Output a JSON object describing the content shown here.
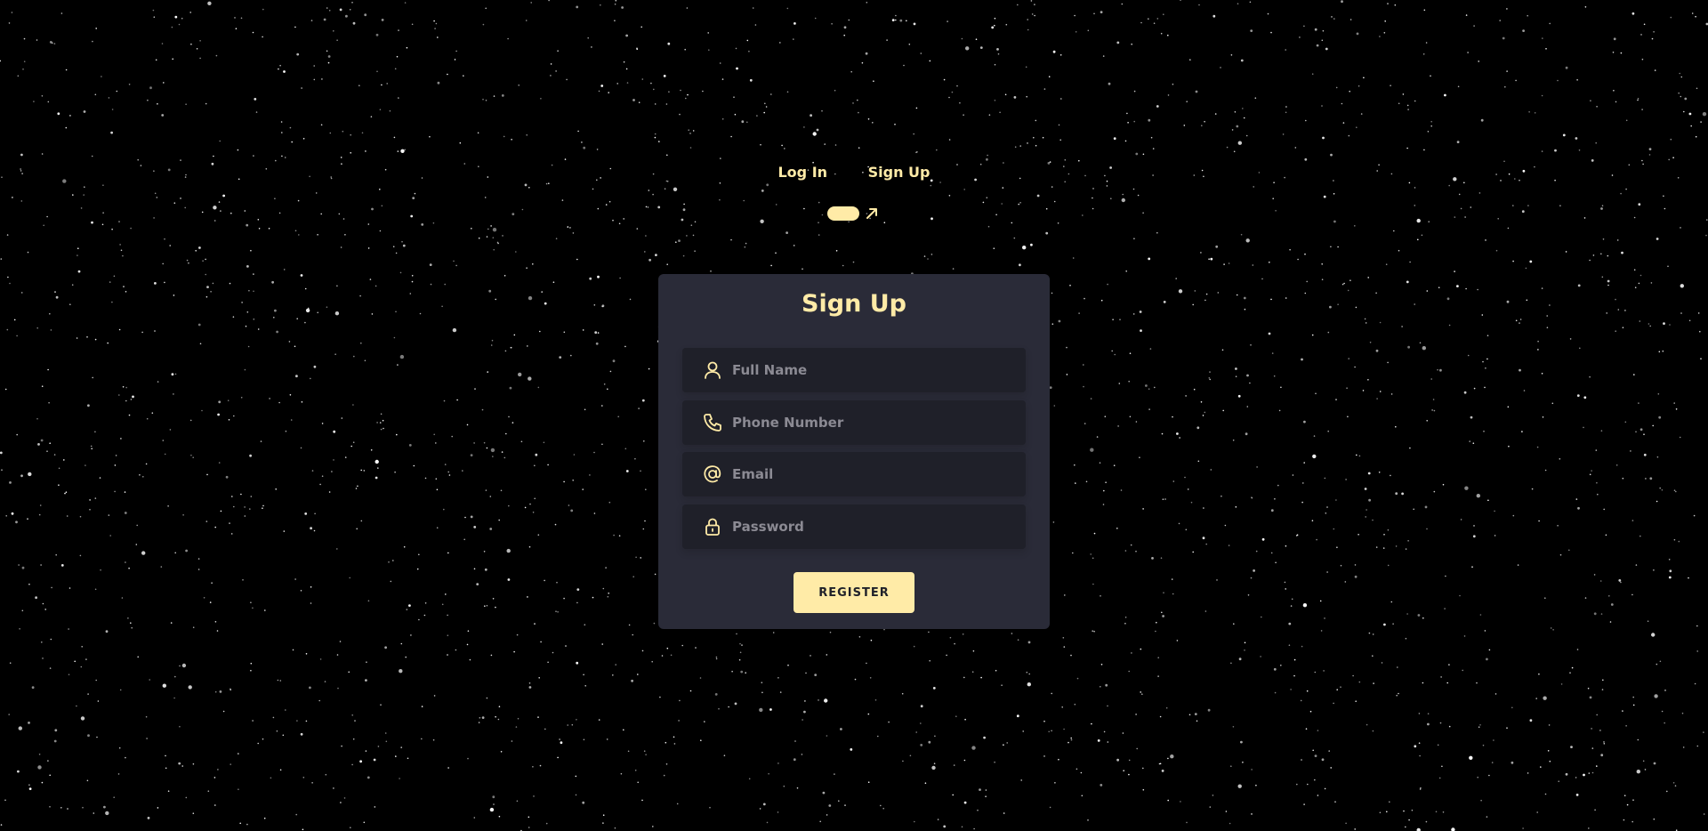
{
  "tabs": {
    "login_label": "Log In",
    "signup_label": "Sign Up"
  },
  "form": {
    "title": "Sign Up",
    "fields": [
      {
        "placeholder": "Full Name",
        "icon": "user-icon"
      },
      {
        "placeholder": "Phone Number",
        "icon": "phone-icon"
      },
      {
        "placeholder": "Email",
        "icon": "at-icon"
      },
      {
        "placeholder": "Password",
        "icon": "lock-icon"
      }
    ],
    "submit_label": "REGISTER"
  },
  "colors": {
    "accent": "#ffeba7",
    "card_bg": "#2a2b38",
    "field_bg": "#1f2029",
    "background": "#000000"
  }
}
